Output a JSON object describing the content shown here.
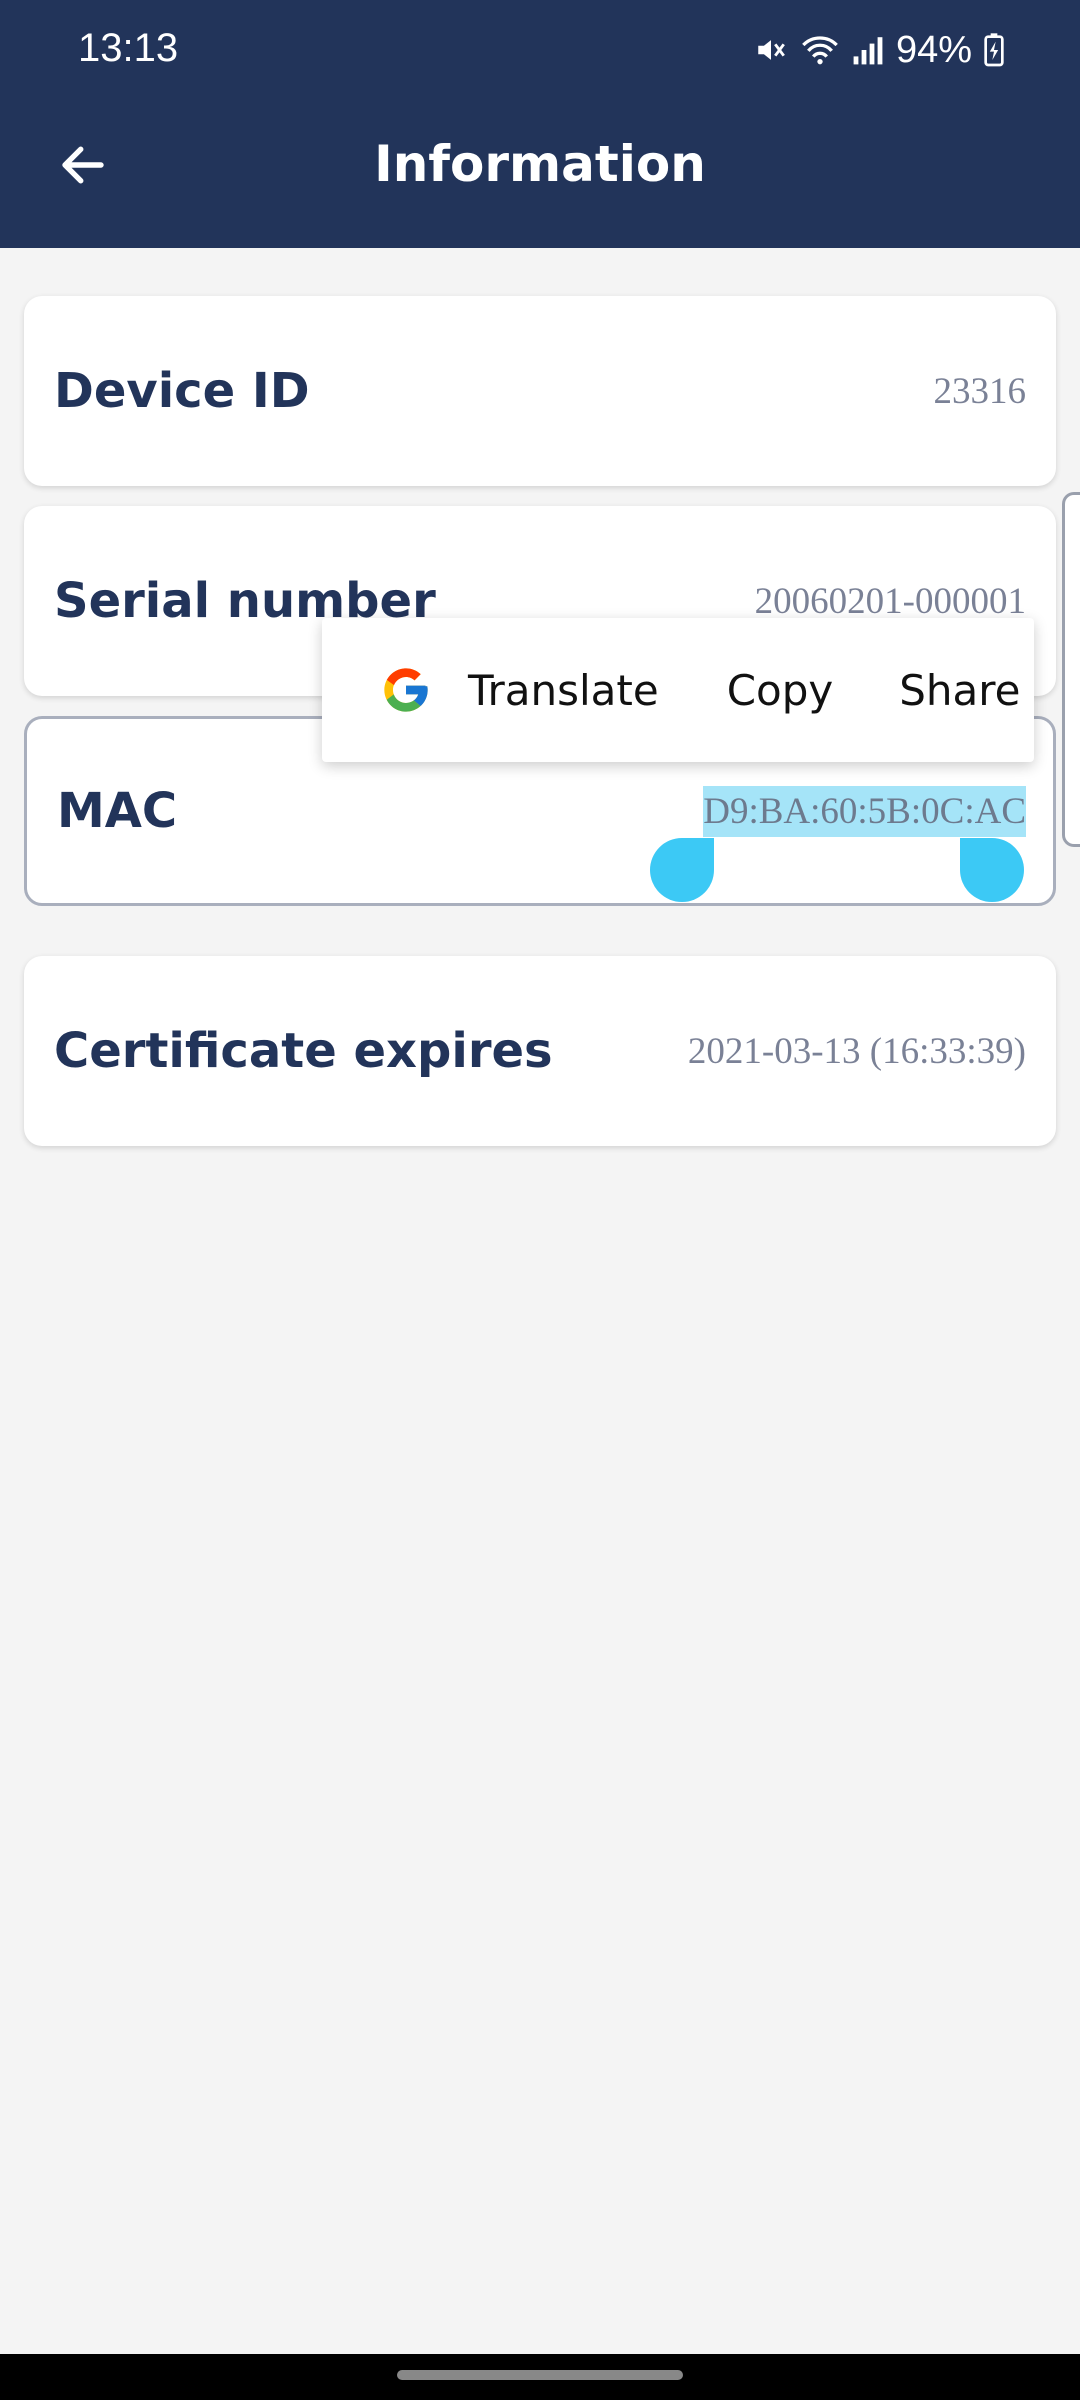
{
  "status_bar": {
    "time": "13:13",
    "battery": "94%",
    "icons": [
      "mute-icon",
      "wifi-icon",
      "signal-icon",
      "battery-charging-icon"
    ]
  },
  "app_bar": {
    "title": "Information",
    "back_icon": "arrow-left-icon"
  },
  "items": [
    {
      "label": "Device ID",
      "value": "23316"
    },
    {
      "label": "Serial number",
      "value": "20060201-000001"
    },
    {
      "label": "MAC",
      "value": "D9:BA:60:5B:0C:AC",
      "selected": true
    },
    {
      "label": "Certificate expires",
      "value": "2021-03-13 (16:33:39)"
    }
  ],
  "context_menu": {
    "translate": "Translate",
    "copy": "Copy",
    "share": "Share",
    "icon": "google-icon"
  },
  "colors": {
    "header": "#22345a",
    "background": "#f4f4f4",
    "label": "#22345a",
    "value": "#7a8196",
    "selection": "#a5e4f8",
    "handle": "#3cc9f5"
  }
}
